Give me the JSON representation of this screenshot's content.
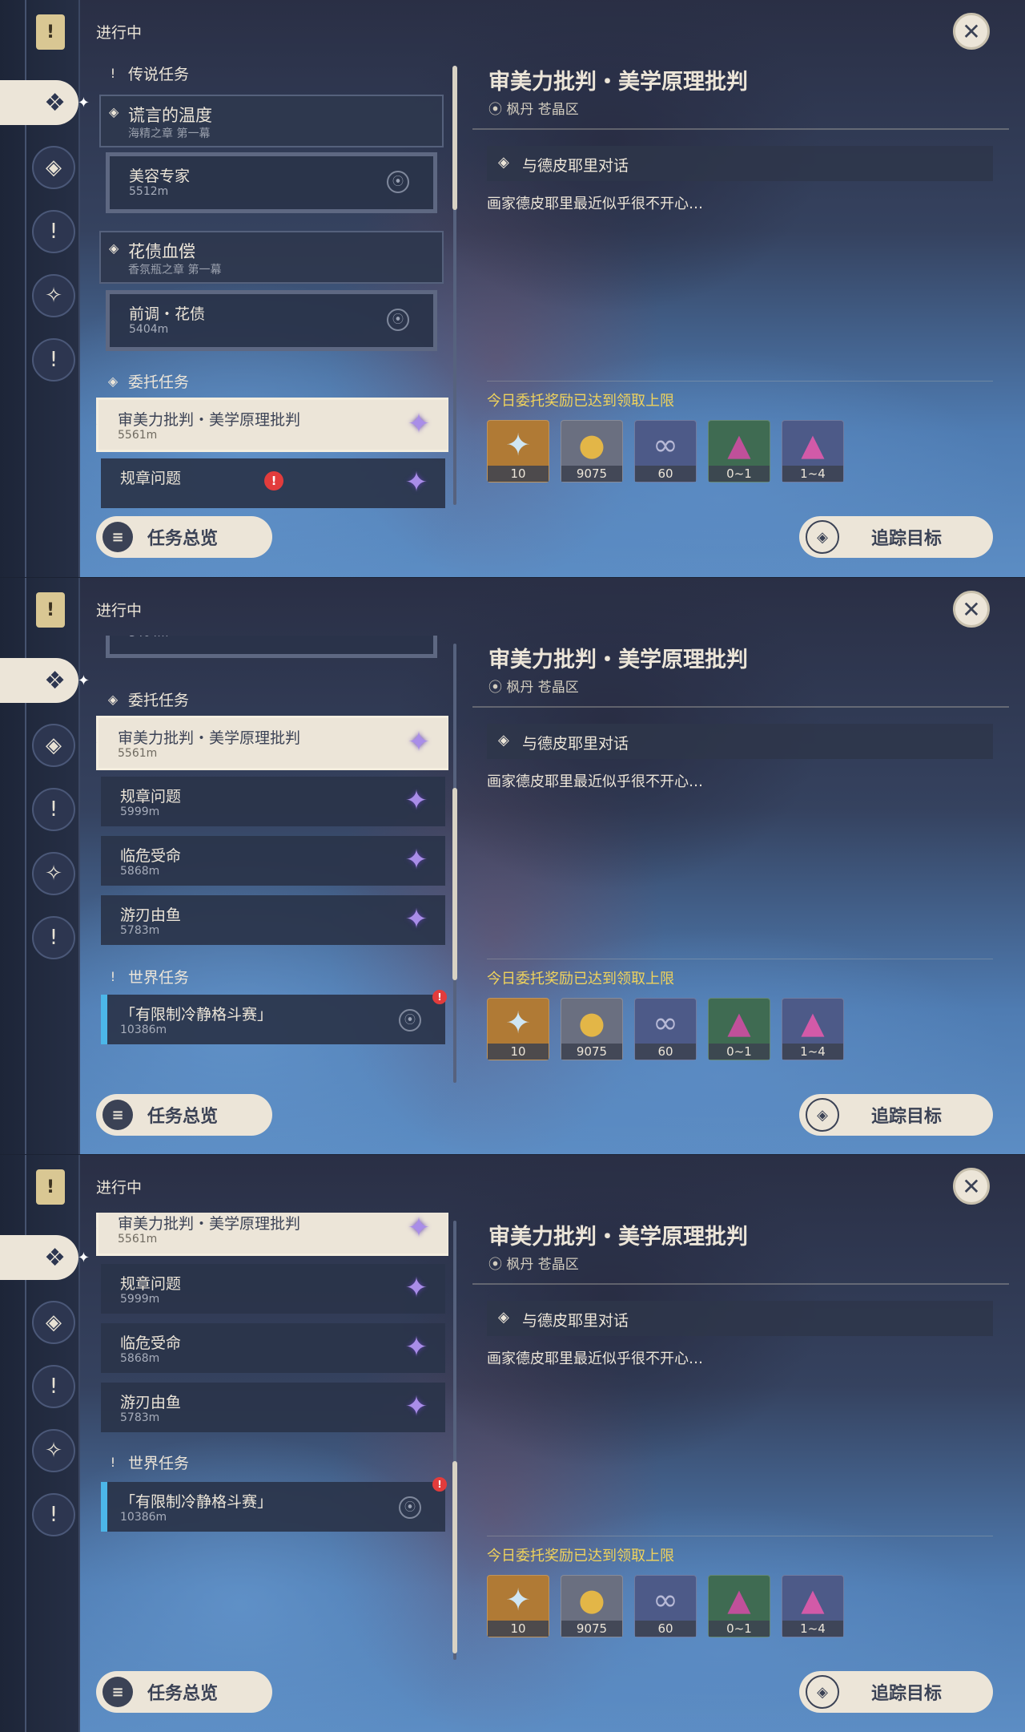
{
  "header": {
    "in_progress": "进行中"
  },
  "rail_icons": [
    "book-icon",
    "commission-icon",
    "legend-icon",
    "alert-icon",
    "star-icon",
    "exclamation-icon"
  ],
  "sections": {
    "legend": "传说任务",
    "commission": "委托任务",
    "world": "世界任务"
  },
  "legend_quests": [
    {
      "name": "谎言的温度",
      "chapter": "海精之章 第一幕",
      "sub_name": "美容专家",
      "sub_dist": "5512m"
    },
    {
      "name": "花债血偿",
      "chapter": "香氛瓶之章 第一幕",
      "sub_name": "前调・花债",
      "sub_dist": "5404m"
    }
  ],
  "commissions": [
    {
      "name": "审美力批判・美学原理批判",
      "dist": "5561m",
      "selected": true
    },
    {
      "name": "规章问题",
      "dist": "5999m",
      "alert": true
    },
    {
      "name": "临危受命",
      "dist": "5868m"
    },
    {
      "name": "游刃由鱼",
      "dist": "5783m"
    }
  ],
  "world_quest": {
    "name": "「有限制冷静格斗赛」",
    "dist": "10386m",
    "badge": "!"
  },
  "detail": {
    "title": "审美力批判・美学原理批判",
    "location": "枫丹 苍晶区",
    "objective": "与德皮耶里对话",
    "description": "画家德皮耶里最近似乎很不开心…",
    "reward_notice": "今日委托奖励已达到领取上限",
    "rewards": [
      {
        "icon": "primogem-icon",
        "count": "10",
        "color": "#b07a35"
      },
      {
        "icon": "mora-icon",
        "count": "9075",
        "color": "#6a6f80"
      },
      {
        "icon": "exp-icon",
        "count": "60",
        "color": "#4d5a88"
      },
      {
        "icon": "crystal-icon",
        "count": "0~1",
        "color": "#3f6b52"
      },
      {
        "icon": "crystal-cluster-icon",
        "count": "1~4",
        "color": "#4d5a88"
      }
    ]
  },
  "buttons": {
    "overview": "任务总览",
    "track": "追踪目标"
  },
  "colors": {
    "accent": "#ece5d8",
    "gold": "#f0d35c",
    "purple_star": "#a98de8",
    "world_blue": "#4cb6e8",
    "alert_red": "#e23c3c"
  }
}
